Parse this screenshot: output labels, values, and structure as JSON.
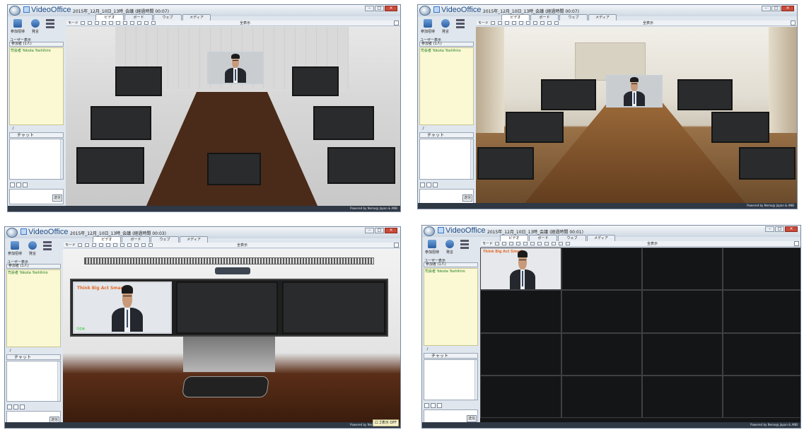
{
  "app": {
    "name": "VideoOffice",
    "tabs": [
      "ビデオ",
      "ボード",
      "ウェブ",
      "メディア"
    ],
    "toolbar_label": "モード",
    "layout_label": "全表示",
    "left": {
      "invite_label": "参加招待",
      "mic_label": "発言",
      "user_view_label": "ユーザー表示",
      "participants_label": "参加者",
      "participant_count": "(1人)",
      "participant_name": "司会者",
      "participant_id": "Yokota Yoshihiro",
      "chat_label": "チャット",
      "send_label": "送信"
    },
    "footer": "Powered by Nemo@ Japan & ANB",
    "camera_banner": "Think Big Act Smart"
  },
  "windows": [
    {
      "title": "2015年_12月_10日_13時_会議 (経過時間 00:07)",
      "layout": "room-1"
    },
    {
      "title": "2015年_12月_10日_13時_会議 (経過時間 00:07)",
      "layout": "room-2"
    },
    {
      "title": "2015年_12月_10日_13時_会議 (経過時間 00:03)",
      "layout": "room-3",
      "badge": "ロゴ表示 OFF"
    },
    {
      "title": "2015年_12月_10日_13時_会議 (経過時間 00:01)",
      "layout": "grid"
    }
  ]
}
